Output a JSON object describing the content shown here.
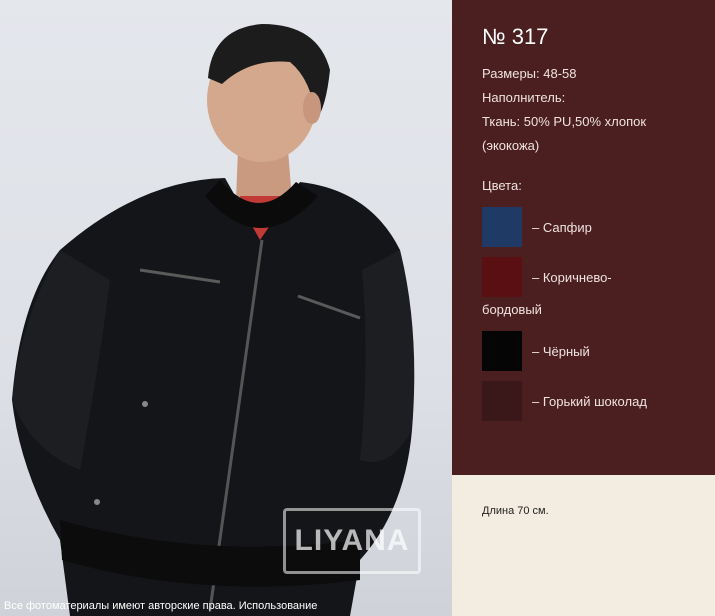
{
  "product": {
    "model": "№ 317",
    "sizes": "Размеры: 48-58",
    "filler": "Наполнитель:",
    "fabric_line1": "Ткань: 50% PU,50% хлопок",
    "fabric_line2": "(экокожа)",
    "colors_title": "Цвета:",
    "colors": [
      {
        "label": "– Сапфир",
        "hex": "#1f3a64"
      },
      {
        "label": "– Коричнево-",
        "label2": "бордовый",
        "hex": "#5a0f12"
      },
      {
        "label": "– Чёрный",
        "hex": "#050505"
      },
      {
        "label": "– Горький шоколад",
        "hex": "#3a1719"
      }
    ],
    "length": "Длина 70 см."
  },
  "photo": {
    "logo_text": "LIYANA",
    "copyright": "Все фотоматериалы имеют  авторские права. Использование"
  },
  "theme": {
    "panel_bg": "#4b1f20",
    "page_bg": "#f3ece0"
  }
}
